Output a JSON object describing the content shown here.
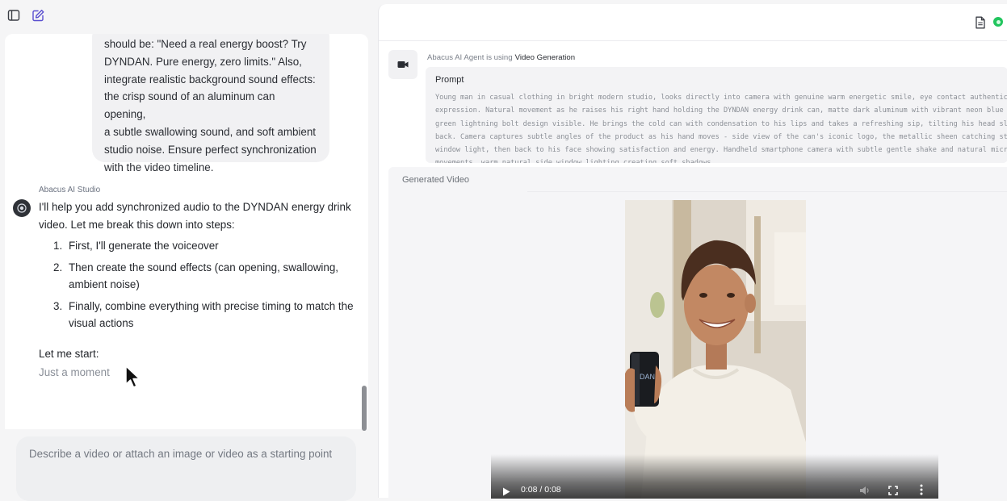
{
  "chat": {
    "user_message_tail": "should be: \"Need a real energy boost? Try\nDYNDAN. Pure energy, zero limits.\" Also,\nintegrate realistic background sound effects:\nthe crisp sound of an aluminum can opening,\na subtle swallowing sound, and soft ambient\nstudio noise. Ensure perfect synchronization\nwith the video timeline.",
    "assistant_name": "Abacus AI Studio",
    "assistant_intro": "I'll help you add synchronized audio to the DYNDAN energy drink video. Let me break this down into steps:",
    "steps": [
      {
        "num": "1.",
        "text": "First, I'll generate the voiceover"
      },
      {
        "num": "2.",
        "text": "Then create the sound effects (can opening, swallowing, ambient noise)"
      },
      {
        "num": "3.",
        "text": "Finally, combine everything with precise timing to match the visual actions"
      }
    ],
    "let_me_start": "Let me start:",
    "status": "Just a moment"
  },
  "composer": {
    "placeholder": "Describe a video or attach an image or video as a starting point"
  },
  "right_panel": {
    "agent_prefix": "Abacus AI Agent is using",
    "tool_name": "Video Generation",
    "prompt_label": "Prompt",
    "prompt_text": "Young man in casual clothing in bright modern studio, looks directly into camera with genuine warm energetic smile, eye contact authentic expression. Natural movement as he raises his right hand holding the DYNDAN energy drink can, matte dark aluminum with vibrant neon blue and green lightning bolt design visible. He brings the cold can with condensation to his lips and takes a refreshing sip, tilting his head slightly back. Camera captures subtle angles of the product as his hand moves - side view of the can's iconic logo, the metallic sheen catching studio window light, then back to his face showing satisfaction and energy. Handheld smartphone camera with subtle gentle shake and natural micro movements, warm natural side window lighting creating soft shadows.",
    "generated_label": "Generated Video",
    "video": {
      "time": "0:08 / 0:08",
      "can_logo": "DAN"
    }
  },
  "colors": {
    "status_dot": "#22c55e",
    "panel_bg": "#f5f5f6",
    "bubble_bg": "#f1f1f3"
  }
}
